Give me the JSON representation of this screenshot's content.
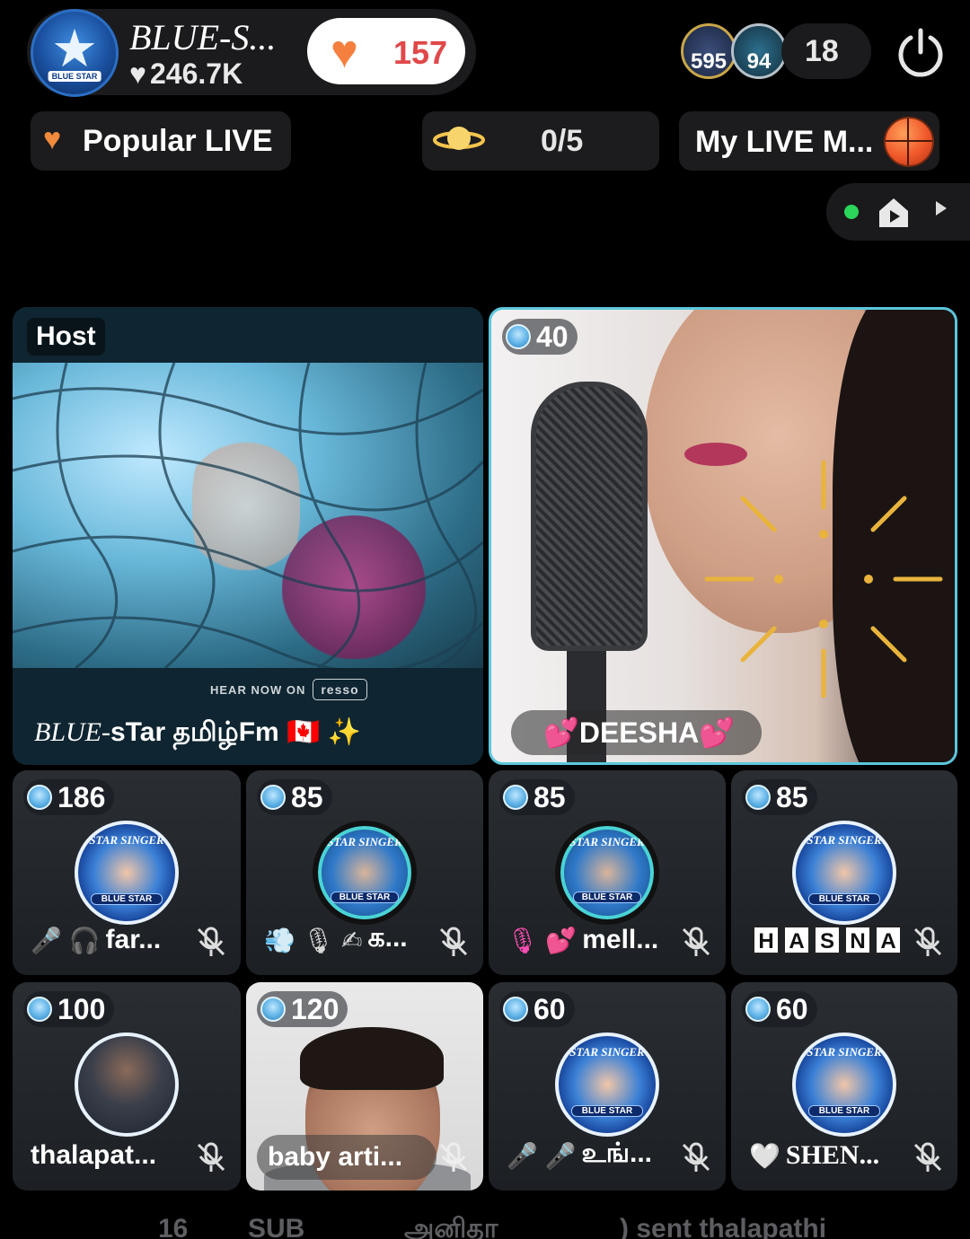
{
  "header": {
    "host_name": "BLUE-S...",
    "host_avatar_tag": "BLUE STAR",
    "host_likes": "246.7K",
    "like_count": "157",
    "viewer_avatars": [
      "595",
      "94"
    ],
    "viewer_count": "18"
  },
  "chips": {
    "popular_label": "Popular LIVE",
    "seats_label": "0/5",
    "mylive_label": "My LIVE M..."
  },
  "host_tile": {
    "label": "Host",
    "promo_text": "HEAR NOW ON",
    "promo_brand": "resso",
    "caption_italic": "BLUE-",
    "caption_rest": "sTar தமிழ்Fm",
    "caption_emoji": "🇨🇦 ✨"
  },
  "guest_tile": {
    "level": "40",
    "name": "DEESHA"
  },
  "seats": [
    {
      "level": "186",
      "avatar_arc": "STAR SINGER",
      "avatar_band": "BLUE STAR",
      "name": "far...",
      "emojis": "🎤 🎧"
    },
    {
      "level": "85",
      "avatar_arc": "STAR SINGER",
      "avatar_band": "BLUE STAR",
      "name": "க...",
      "emojis": "💨 🎙 ✍"
    },
    {
      "level": "85",
      "avatar_arc": "STAR SINGER",
      "avatar_band": "BLUE STAR",
      "name": "mell...",
      "emojis": "🎙 💕"
    },
    {
      "level": "85",
      "avatar_arc": "STAR SINGER",
      "avatar_band": "BLUE STAR",
      "name_letters": [
        "H",
        "A",
        "S",
        "N",
        "A"
      ]
    },
    {
      "level": "100",
      "name": "thalapat..."
    },
    {
      "level": "120",
      "name": "baby arti..."
    },
    {
      "level": "60",
      "avatar_arc": "STAR SINGER",
      "avatar_band": "BLUE STAR",
      "name": "உங்...",
      "emojis": "🎤 🎤"
    },
    {
      "level": "60",
      "avatar_arc": "STAR SINGER",
      "avatar_band": "BLUE STAR",
      "name": "SHEN...",
      "emojis": "🤍"
    }
  ],
  "ticker": {
    "badge_num": "16",
    "sub_label": "SUB",
    "user_name": "அனிதா",
    "message": ") sent thalapathi"
  },
  "colors": {
    "accent_cyan": "#5bc7dc",
    "like_heart": "#f47f3f",
    "like_count": "#e0484a",
    "live_dot": "#2bd65a"
  }
}
